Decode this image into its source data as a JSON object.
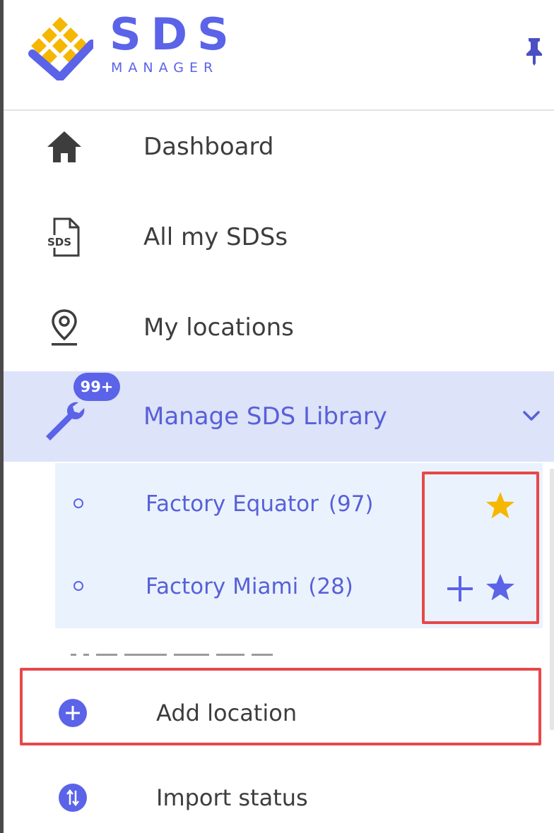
{
  "brand": {
    "name": "SDS",
    "subtitle": "MANAGER",
    "colors": {
      "primary": "#5b63e8",
      "gold": "#f5b700",
      "highlight": "#e8474a",
      "active_bg": "#dde3f8",
      "submenu_bg": "#eaf3fd"
    }
  },
  "header": {
    "pin_icon": "pin-icon"
  },
  "nav": {
    "items": [
      {
        "label": "Dashboard",
        "icon": "home-icon",
        "active": false
      },
      {
        "label": "All my SDSs",
        "icon": "sds-document-icon",
        "active": false
      },
      {
        "label": "My locations",
        "icon": "location-pin-icon",
        "active": false
      },
      {
        "label": "Manage SDS Library",
        "icon": "wrench-icon",
        "active": true,
        "badge": "99+",
        "expanded": true
      }
    ]
  },
  "submenu": {
    "items": [
      {
        "name": "Factory Equator",
        "count": "(97)",
        "favorite": true
      },
      {
        "name": "Factory Miami",
        "count": "(28)",
        "favorite": false
      }
    ]
  },
  "actions": [
    {
      "label": "Add location",
      "icon": "plus-circle-icon"
    },
    {
      "label": "Import status",
      "icon": "import-status-icon"
    }
  ]
}
